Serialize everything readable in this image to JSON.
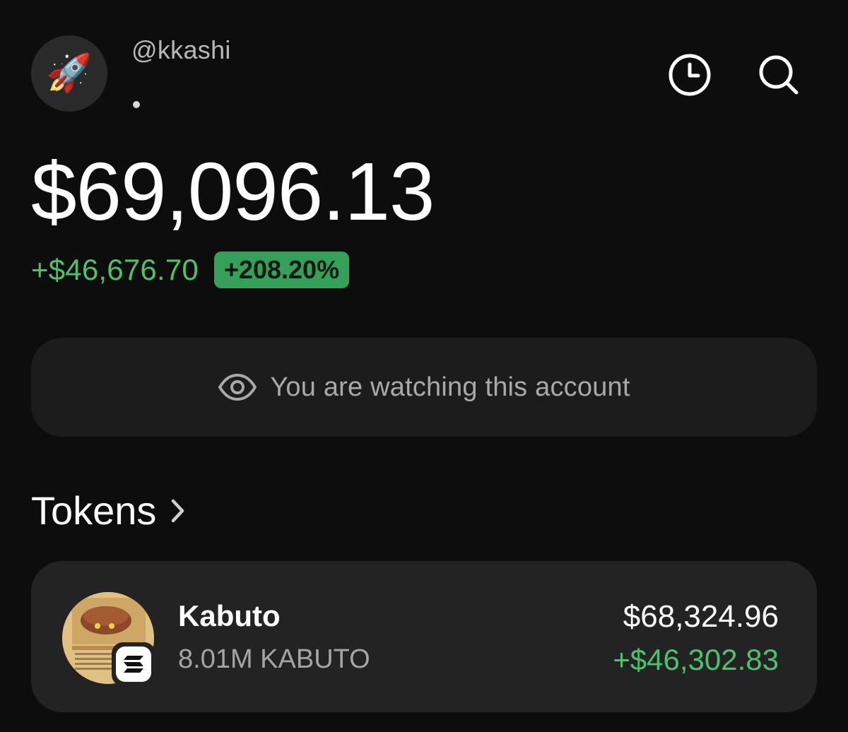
{
  "profile": {
    "avatar_emoji": "🚀",
    "handle": "@kkashi"
  },
  "header": {
    "history_icon": "clock-icon",
    "search_icon": "search-icon"
  },
  "portfolio": {
    "balance": "$69,096.13",
    "change_amount": "+$46,676.70",
    "change_percent": "+208.20%"
  },
  "watching": {
    "icon": "eye-icon",
    "text": "You are watching this account"
  },
  "tokens": {
    "title": "Tokens",
    "items": [
      {
        "name": "Kabuto",
        "amount": "8.01M KABUTO",
        "value": "$68,324.96",
        "change": "+$46,302.83",
        "chain_icon": "solana-icon"
      }
    ]
  },
  "colors": {
    "background": "#0d0d0d",
    "positive": "#4cc26e",
    "badge": "#35a05a",
    "card": "#232323"
  }
}
